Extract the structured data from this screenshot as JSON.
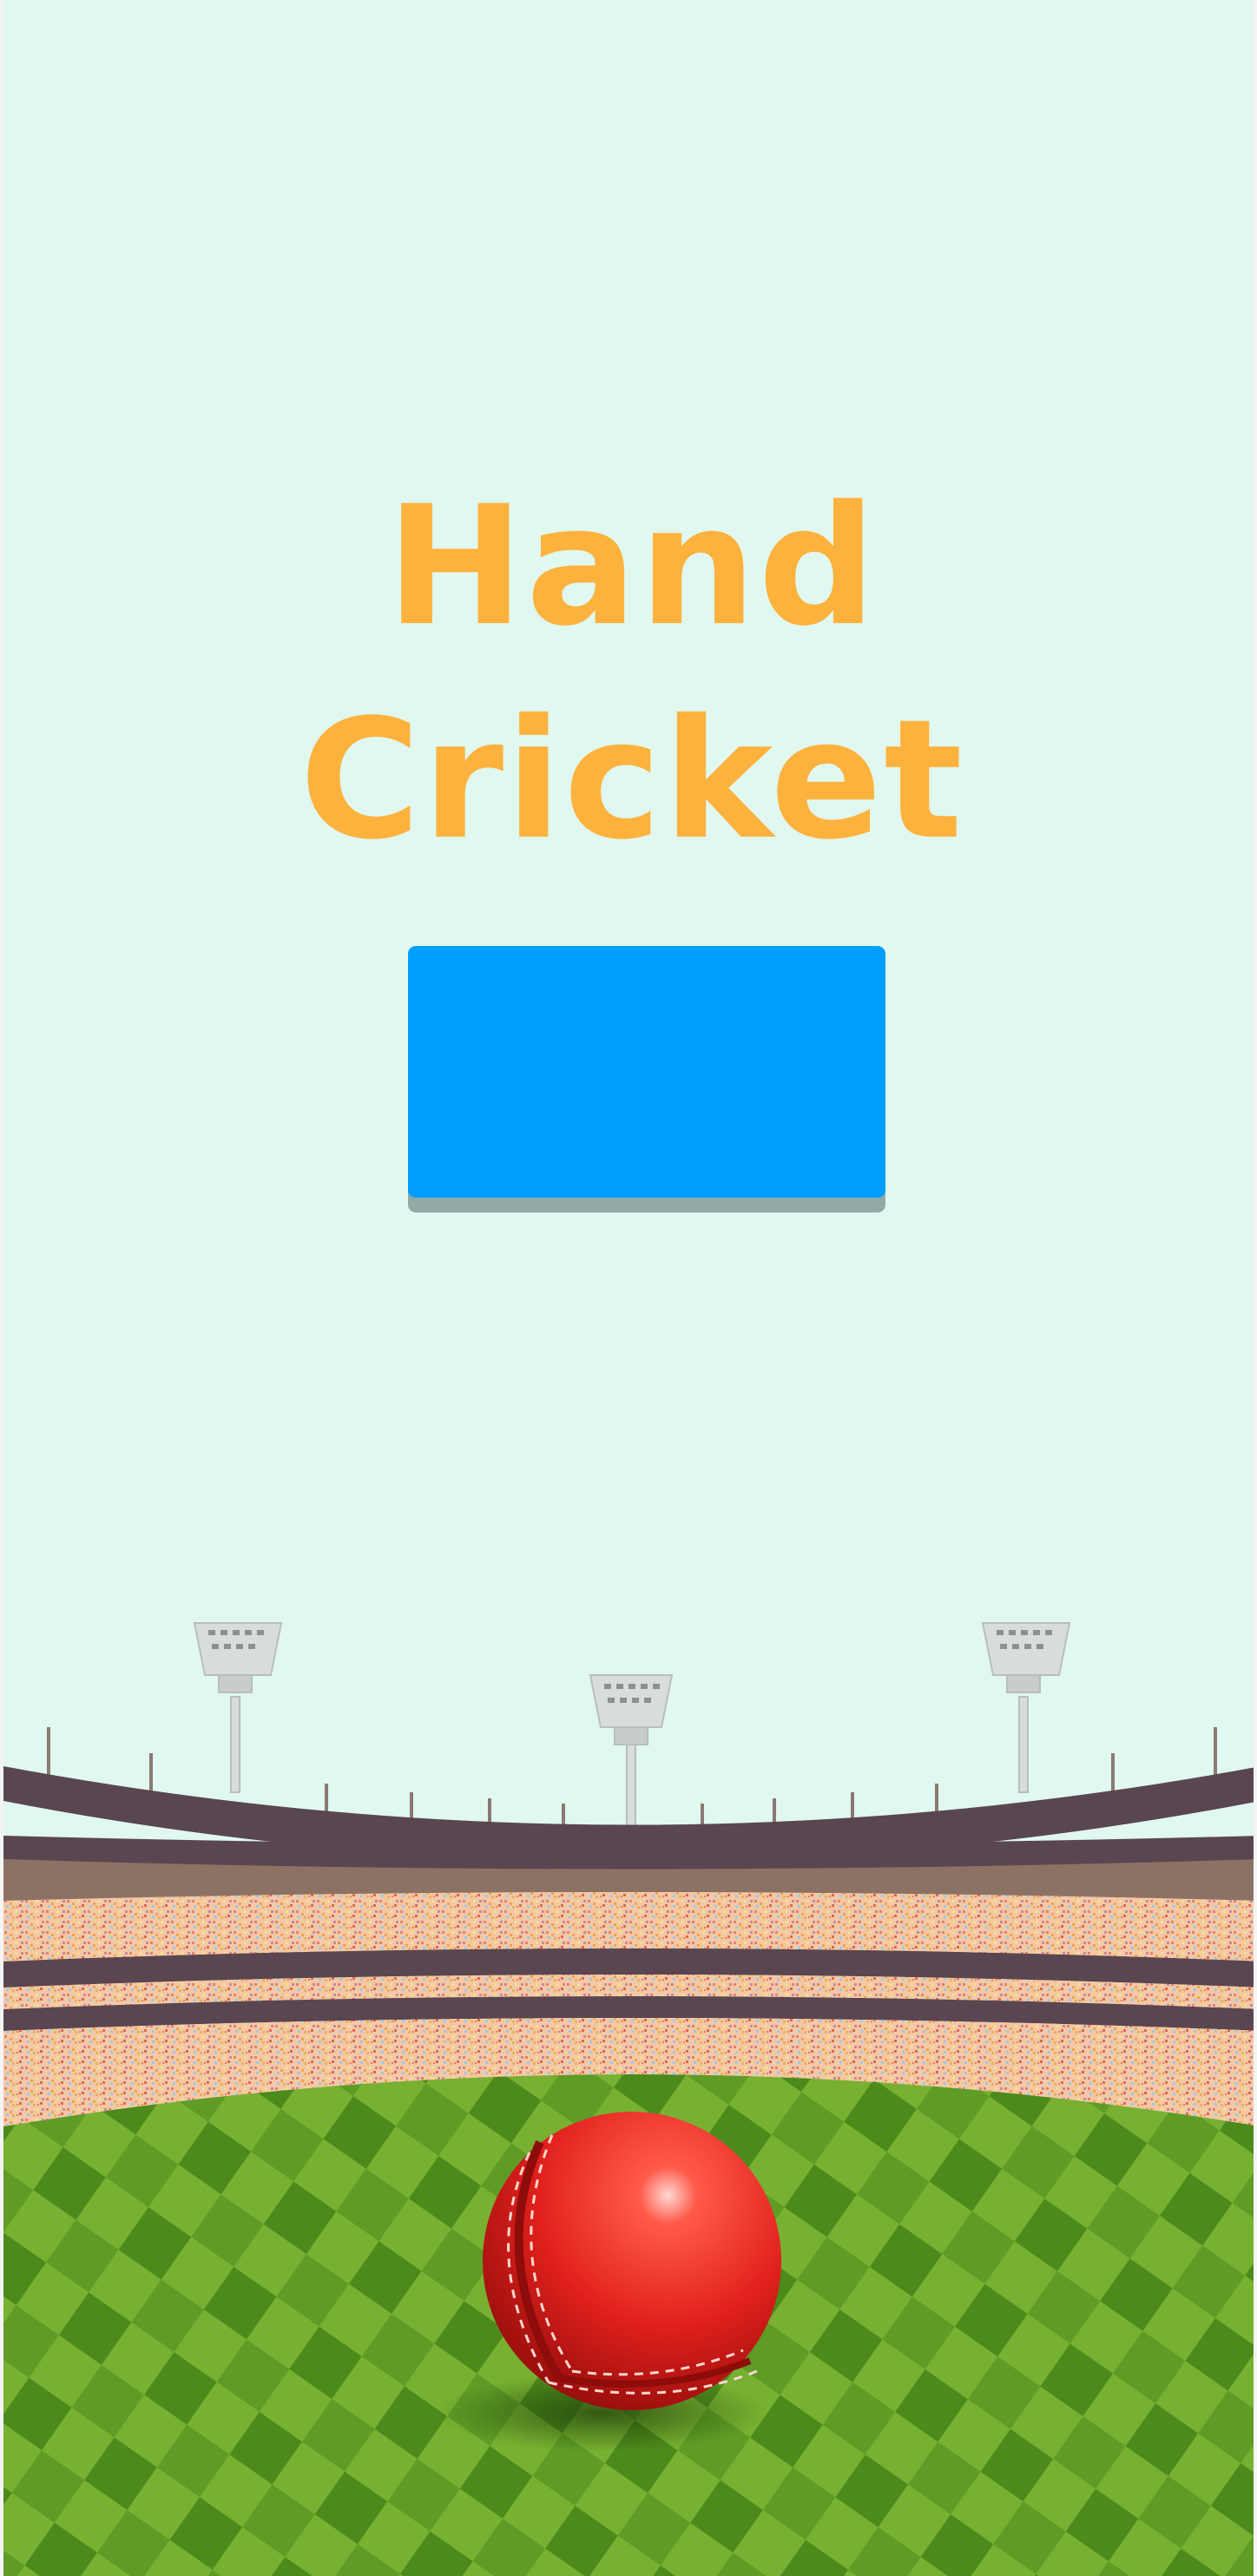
{
  "game": {
    "title_line1": "Hand",
    "title_line2": "Cricket",
    "start_button_label": ""
  },
  "colors": {
    "background": "#e0f8ef",
    "title": "#fdb23e",
    "button": "#009ffd",
    "button_shadow": "#93a9a6",
    "ball": "#e0201c",
    "grass_dark": "#4f8e1e",
    "grass_light": "#8fc23c",
    "stand_roof": "#5a4650",
    "stand_wall": "#8c7264",
    "crowd_base": "#f4c9a8"
  },
  "icons": {
    "stadium": "stadium-illustration-icon",
    "ball": "cricket-ball-icon",
    "floodlight": "floodlight-icon"
  }
}
